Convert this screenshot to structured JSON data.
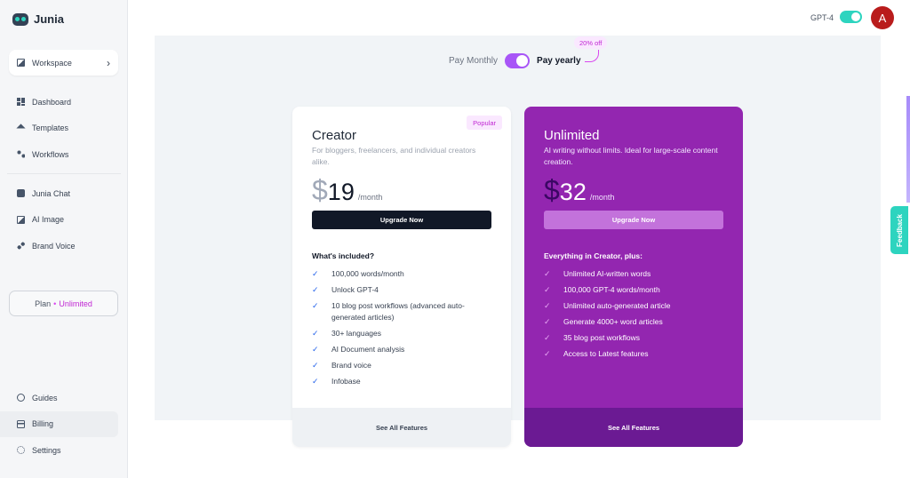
{
  "brand": {
    "name": "Junia"
  },
  "sidebar": {
    "workspace_label": "Workspace",
    "items_top": [
      {
        "label": "Dashboard",
        "icon": "dashboard-icon"
      },
      {
        "label": "Templates",
        "icon": "templates-icon"
      },
      {
        "label": "Workflows",
        "icon": "workflows-icon"
      }
    ],
    "items_mid": [
      {
        "label": "Junia Chat",
        "icon": "chat-icon"
      },
      {
        "label": "AI Image",
        "icon": "image-icon"
      },
      {
        "label": "Brand Voice",
        "icon": "brand-voice-icon"
      }
    ],
    "plan": {
      "label": "Plan",
      "separator": "•",
      "value": "Unlimited"
    },
    "items_bottom": [
      {
        "label": "Guides",
        "icon": "guides-icon"
      },
      {
        "label": "Billing",
        "icon": "billing-icon",
        "active": true
      },
      {
        "label": "Settings",
        "icon": "settings-icon"
      }
    ]
  },
  "header": {
    "model_label": "GPT-4",
    "model_toggle_on": true,
    "avatar_initial": "A"
  },
  "billing": {
    "monthly_label": "Pay Monthly",
    "yearly_label": "Pay yearly",
    "yearly_selected": true,
    "discount_badge": "20% off"
  },
  "plans": {
    "creator": {
      "name": "Creator",
      "badge": "Popular",
      "description": "For bloggers, freelancers, and individual creators alike.",
      "currency": "$",
      "price": "19",
      "period": "/month",
      "cta": "Upgrade Now",
      "included_heading": "What's included?",
      "features": [
        "100,000 words/month",
        "Unlock GPT-4",
        "10 blog post workflows (advanced auto-generated articles)",
        "30+ languages",
        "AI Document analysis",
        "Brand voice",
        "Infobase"
      ],
      "footer": "See All Features"
    },
    "unlimited": {
      "name": "Unlimited",
      "description": "AI writing without limits. Ideal for large-scale content creation.",
      "currency": "$",
      "price": "32",
      "period": "/month",
      "cta": "Upgrade Now",
      "included_heading": "Everything in Creator, plus:",
      "features": [
        "Unlimited AI-written words",
        "100,000 GPT-4 words/month",
        "Unlimited auto-generated article",
        "Generate 4000+ word articles",
        "35 blog post workflows",
        "Access to Latest features"
      ],
      "footer": "See All Features"
    }
  },
  "feedback_label": "Feedback",
  "colors": {
    "accent_teal": "#2dd4bf",
    "accent_purple": "#9326b0",
    "accent_pink": "#c026d3",
    "dark": "#111827"
  }
}
